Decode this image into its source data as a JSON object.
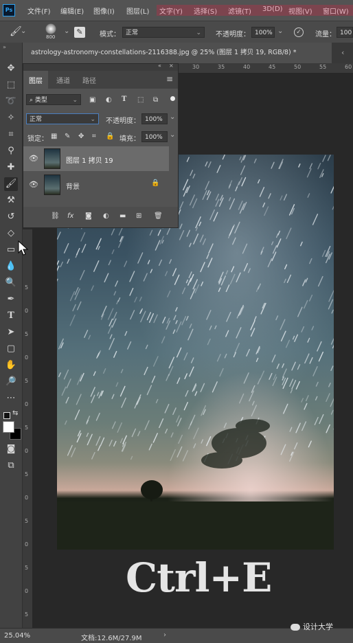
{
  "app": {
    "logo": "Ps"
  },
  "menu": [
    "文件(F)",
    "编辑(E)",
    "图像(I)",
    "图层(L)",
    "文字(Y)",
    "选择(S)",
    "滤镜(T)",
    "3D(D)",
    "视图(V)",
    "窗口(W)"
  ],
  "options": {
    "brush_size": "800",
    "mode_label": "模式：",
    "mode_value": "正常",
    "opacity_label": "不透明度：",
    "opacity_value": "100%",
    "flow_label": "流量：",
    "flow_value": "100"
  },
  "document_tab": {
    "title": "astrology-astronomy-constellations-2116388.jpg @ 25% (图层 1 拷贝 19, RGB/8) *",
    "close": "×"
  },
  "ruler_top": [
    "30",
    "35",
    "40",
    "45",
    "50",
    "55",
    "60"
  ],
  "ruler_left": [
    "5",
    "0",
    "5",
    "0",
    "5",
    "0",
    "5",
    "0",
    "5",
    "0",
    "5",
    "0",
    "5",
    "0",
    "5"
  ],
  "layers_panel": {
    "tabs": [
      "图层",
      "通道",
      "路径"
    ],
    "filter_kind": "类型",
    "blend_mode": "正常",
    "opacity_label": "不透明度：",
    "opacity_value": "100%",
    "lock_label": "锁定：",
    "fill_label": "填充：",
    "fill_value": "100%",
    "layers": [
      {
        "name": "图层 1 拷贝 19",
        "selected": true,
        "locked": false
      },
      {
        "name": "背景",
        "selected": false,
        "locked": true
      }
    ]
  },
  "canvas_overlay_text": "Ctrl+E",
  "status": {
    "zoom": "25.04%",
    "doc_info": "文档:12.6M/27.9M"
  },
  "watermark": "设计大学"
}
